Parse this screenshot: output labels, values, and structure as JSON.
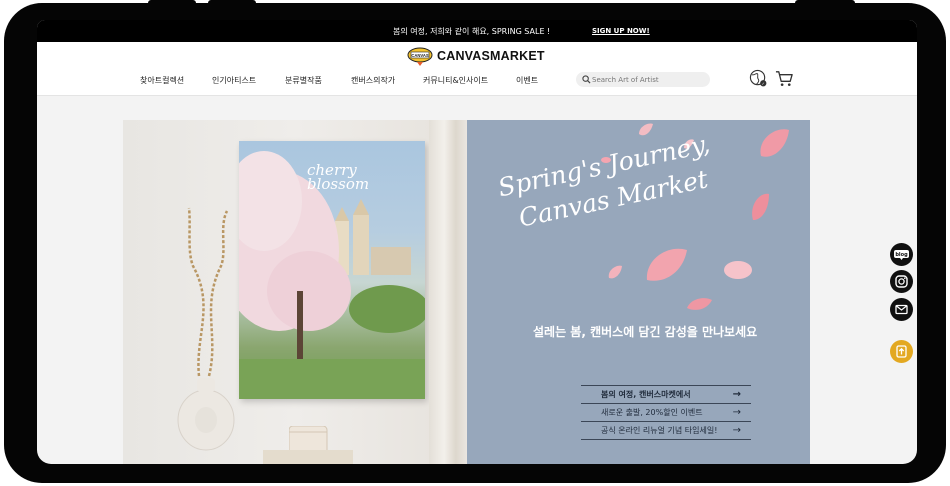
{
  "announcement": {
    "message": "봄의 여정, 저희와 같이 해요, SPRING SALE !",
    "signup": "SIGN UP NOW!"
  },
  "header": {
    "logo_text": "CANVASMARKET",
    "logo_badge_text": "CANVAS",
    "nav": [
      "찾아트컬렉션",
      "인기아티스트",
      "분류별작품",
      "캔버스의작가",
      "커뮤니티&인사이트",
      "이벤트"
    ],
    "search_placeholder": "Search Art of Artist",
    "icons": [
      "language-globe-icon",
      "cart-icon"
    ]
  },
  "hero": {
    "poster_title_line1": "cherry",
    "poster_title_line2": "blossom",
    "headline_line1": "Spring's Journey,",
    "headline_line2": "Canvas Market",
    "subheadline": "설레는 봄, 캔버스에 담긴 감성을 만나보세요",
    "menu": [
      {
        "label": "봄의 여정, 캔버스마켓에서",
        "arrow": "→"
      },
      {
        "label": "새로운 출발, 20%할인 이벤트",
        "arrow": "→"
      },
      {
        "label": "공식 온라인 리뉴얼 기념 타임세일!",
        "arrow": "→"
      }
    ]
  },
  "floating": [
    {
      "name": "blog-button",
      "label": "blog"
    },
    {
      "name": "instagram-button",
      "label": ""
    },
    {
      "name": "email-button",
      "label": ""
    },
    {
      "name": "scroll-top-button",
      "label": ""
    }
  ],
  "colors": {
    "hero_right_bg": "#97a7bb",
    "announcement_bg": "#000000",
    "scroll_top_bg": "#e3a821"
  }
}
